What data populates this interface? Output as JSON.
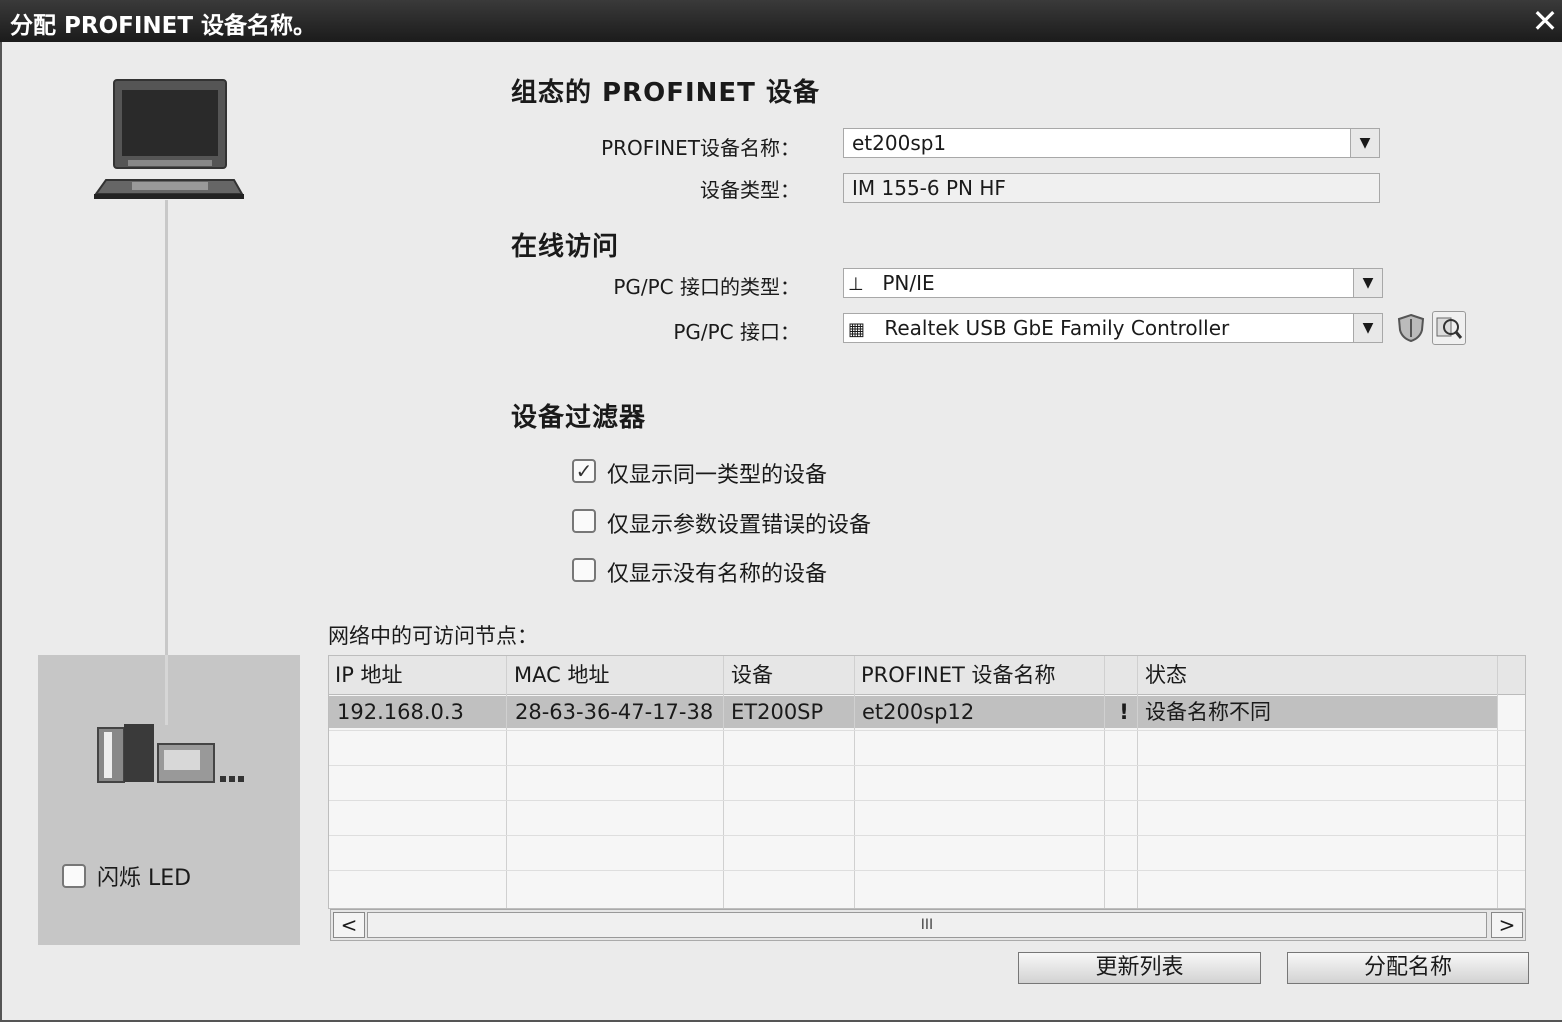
{
  "window": {
    "title": "分配 PROFINET 设备名称。",
    "close_glyph": "✕"
  },
  "configured": {
    "section_title": "组态的 PROFINET 设备",
    "name_label": "PROFINET设备名称：",
    "name_value": "et200sp1",
    "type_label": "设备类型：",
    "type_value": "IM 155-6 PN HF"
  },
  "online": {
    "section_title": "在线访问",
    "iface_type_label": "PG/PC 接口的类型：",
    "iface_type_value": "PN/IE",
    "iface_label": "PG/PC 接口：",
    "iface_value": "Realtek USB GbE Family Controller"
  },
  "filter": {
    "section_title": "设备过滤器",
    "options": [
      {
        "label": "仅显示同一类型的设备",
        "checked": true
      },
      {
        "label": "仅显示参数设置错误的设备",
        "checked": false
      },
      {
        "label": "仅显示没有名称的设备",
        "checked": false
      }
    ]
  },
  "nodes": {
    "title": "网络中的可访问节点：",
    "columns": [
      "IP 地址",
      "MAC 地址",
      "设备",
      "PROFINET 设备名称",
      "状态"
    ],
    "rows": [
      {
        "ip": "192.168.0.3",
        "mac": "28-63-36-47-17-38",
        "device": "ET200SP",
        "name": "et200sp12",
        "status_icon": "!",
        "status": "设备名称不同"
      }
    ],
    "scroll_thumb": "III"
  },
  "left": {
    "flash_led_label": "闪烁 LED",
    "flash_led_checked": false
  },
  "buttons": {
    "refresh": "更新列表",
    "assign": "分配名称"
  },
  "icons": [
    "pc-laptop-icon",
    "device-module-icon",
    "network-icon",
    "nic-card-icon",
    "shield-icon",
    "search-device-icon",
    "dropdown-arrow-icon",
    "warning-icon"
  ]
}
